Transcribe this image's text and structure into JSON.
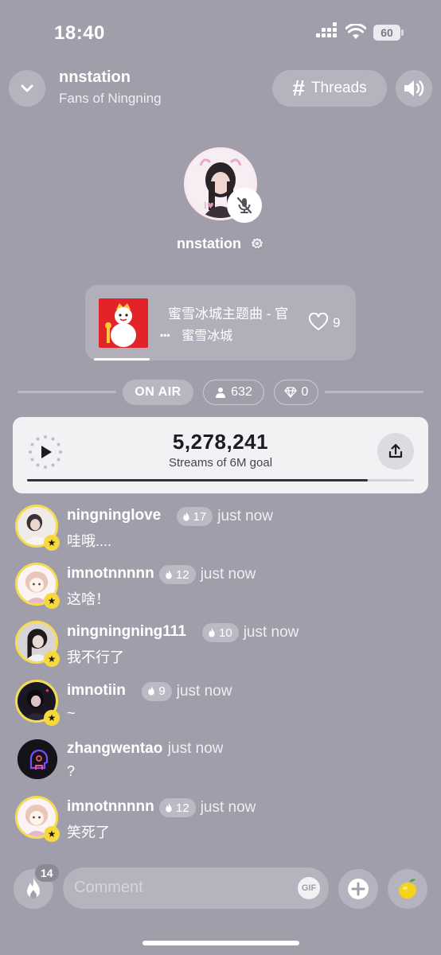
{
  "status": {
    "time": "18:40",
    "battery": "60"
  },
  "header": {
    "room_name": "nnstation",
    "room_subtitle": "Fans of Ningning",
    "threads_label": "Threads",
    "threads_hash": "#"
  },
  "host": {
    "name": "nnstation"
  },
  "music": {
    "title": "蜜雪冰城主题曲 - 官",
    "artist": "蜜雪冰城",
    "likes": "9",
    "progress_fraction": 0.2
  },
  "live": {
    "on_air_label": "ON AIR",
    "listeners": "632",
    "gems": "0"
  },
  "goal": {
    "count": "5,278,241",
    "label": "Streams of 6M goal",
    "progress_fraction": 0.88
  },
  "comments": [
    {
      "name": "ningninglove",
      "badge": "17",
      "time": "just now",
      "text": "哇哦....",
      "avatar": "portrait-light",
      "star": true
    },
    {
      "name": "imnotnnnnn",
      "badge": "12",
      "time": "just now",
      "text": "这啥！",
      "avatar": "doll",
      "star": true
    },
    {
      "name": "ningningning111",
      "badge": "10",
      "time": "just now",
      "text": "我不行了",
      "avatar": "portrait-dark",
      "star": true
    },
    {
      "name": "imnotiin",
      "badge": "9",
      "time": "just now",
      "text": "~",
      "avatar": "portrait-night",
      "star": true
    },
    {
      "name": "zhangwentao",
      "badge": "",
      "time": "just now",
      "text": "?",
      "avatar": "neon-head",
      "star": false
    },
    {
      "name": "imnotnnnnn",
      "badge": "12",
      "time": "just now",
      "text": "笑死了",
      "avatar": "doll",
      "star": true
    }
  ],
  "composer": {
    "fire_count": "14",
    "placeholder": "Comment",
    "gif_label": "GIF"
  },
  "colors": {
    "background": "#a19eac",
    "card": "#f2f2f4",
    "star": "#f8d93c",
    "album": "#e3232a"
  },
  "icons": [
    "chevron-down-icon",
    "hash-icon",
    "volume-icon",
    "mic-muted-icon",
    "verified-icon",
    "heart-icon",
    "person-icon",
    "diamond-icon",
    "play-icon",
    "share-icon",
    "flame-icon",
    "star-icon",
    "gif-icon",
    "plus-icon",
    "lemon-icon"
  ]
}
